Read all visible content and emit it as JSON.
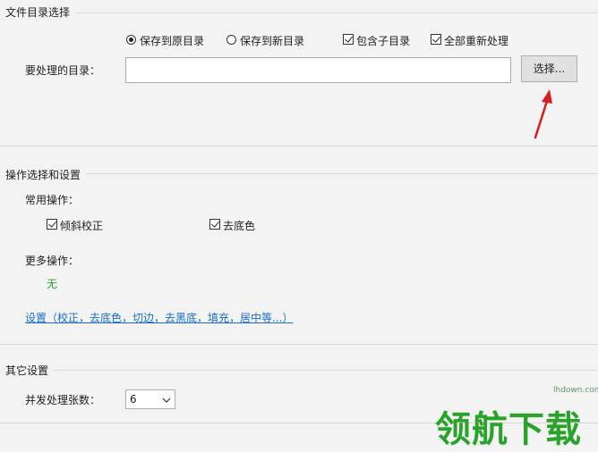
{
  "sections": {
    "directory": {
      "title": "文件目录选择",
      "radio_keep_original": "保存到原目录",
      "radio_new_dir": "保存到新目录",
      "check_subdirs": "包含子目录",
      "check_reprocess_all": "全部重新处理",
      "dir_label": "要处理的目录：",
      "dir_value": "",
      "choose_button": "选择..."
    },
    "operations": {
      "title": "操作选择和设置",
      "common_label": "常用操作：",
      "check_deskew": "倾斜校正",
      "check_remove_bg": "去底色",
      "more_label": "更多操作：",
      "more_value": "无",
      "settings_link": "设置（校正，去底色，切边，去黑底，填充，居中等...）"
    },
    "other": {
      "title": "其它设置",
      "concurrency_label": "并发处理张数：",
      "concurrency_value": "6"
    }
  },
  "watermark": {
    "url": "lhdown.com",
    "text": "领航下载"
  },
  "colors": {
    "background": "#f3f3f3",
    "link": "#1a6ec4",
    "more_value": "#2e9d2e",
    "arrow": "#d22020",
    "watermark": "#2aa32a"
  }
}
